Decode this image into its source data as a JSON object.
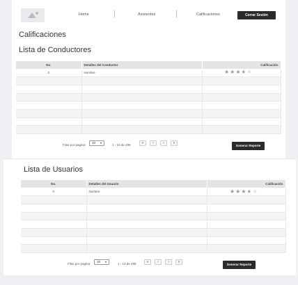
{
  "nav": {
    "home": "Home",
    "asistentes": "Asistentes",
    "calificaciones": "Calificaciones",
    "logout": "Cerrar Sesión"
  },
  "page_title": "Calificaciones",
  "drivers": {
    "title": "Lista de Conductores",
    "columns": [
      "No.",
      "Detalles del Conductor",
      "Calificación"
    ],
    "rows": [
      {
        "no": "0",
        "detail": "Nombre",
        "rating": 3.5
      }
    ],
    "rows_per_page_label": "Filas por pagina:",
    "rows_per_page": "10",
    "range": "1 - 10 de 496",
    "report_button": "Generar Reporte"
  },
  "users": {
    "title": "Lista de Usuarios",
    "columns": [
      "No.",
      "Detalles del Usuario",
      "Calificación"
    ],
    "rows": [
      {
        "no": "0",
        "detail": "Nombre",
        "rating": 3.5
      }
    ],
    "rows_per_page_label": "Filas por pagina:",
    "rows_per_page": "10",
    "range": "1 - 10 de 496",
    "report_button": "Generar Reporte"
  },
  "pager_icons": [
    "first-page-icon",
    "prev-page-icon",
    "next-page-icon",
    "last-page-icon"
  ]
}
